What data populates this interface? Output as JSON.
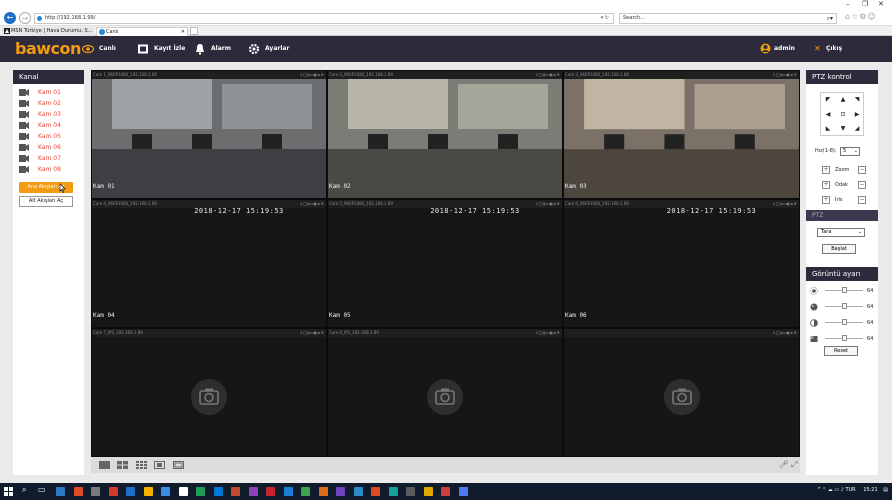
{
  "browser": {
    "url": "http://192.168.1.99/",
    "search_placeholder": "Search...",
    "tabs": [
      {
        "label": "MSN Türkiye | Hava Durumu, S..."
      },
      {
        "label": "Canlı"
      }
    ]
  },
  "app": {
    "logo": "bawcon",
    "nav": [
      {
        "label": "Canlı",
        "icon": "eye-icon"
      },
      {
        "label": "Kayıt İzle",
        "icon": "film-icon"
      },
      {
        "label": "Alarm",
        "icon": "bell-icon"
      },
      {
        "label": "Ayarlar",
        "icon": "gear-icon"
      }
    ],
    "user": "admin",
    "logout": "Çıkış",
    "accent_color": "#f39c12",
    "header_color": "#2c2a3b"
  },
  "left_panel": {
    "title": "Kanal",
    "channels": [
      "Kam 01",
      "Kam 02",
      "Kam 03",
      "Kam 04",
      "Kam 05",
      "Kam 06",
      "Kam 07",
      "Kam 08"
    ],
    "btn_main": "Ana Akışları Aç",
    "btn_sub": "Alt Akışları Aç"
  },
  "grid": {
    "cells": [
      {
        "header": "Cam 1_960P1080_192.168.1.89",
        "name": "Kam 01",
        "timestamp": "",
        "state": "video"
      },
      {
        "header": "Cam 2_960P1080_192.168.1.89",
        "name": "Kam 02",
        "timestamp": "",
        "state": "video"
      },
      {
        "header": "Cam 3_960P1080_192.168.1.89",
        "name": "Kam 03",
        "timestamp": "",
        "state": "video"
      },
      {
        "header": "Cam 4_960P1080_192.168.1.89",
        "name": "Kam 04",
        "timestamp": "2018-12-17 15:19:53",
        "state": "dark"
      },
      {
        "header": "Cam 5_960P1080_192.168.1.89",
        "name": "Kam 05",
        "timestamp": "2018-12-17 15:19:53",
        "state": "dark"
      },
      {
        "header": "Cam 6_960P1080_192.168.1.89",
        "name": "Kam 06",
        "timestamp": "2018-12-17 15:19:53",
        "state": "dark"
      },
      {
        "header": "Cam 7_IPS_192.168.1.89",
        "name": "",
        "timestamp": "",
        "state": "empty"
      },
      {
        "header": "Cam 8_IPS_192.168.1.89",
        "name": "",
        "timestamp": "",
        "state": "empty"
      },
      {
        "header": "",
        "name": "",
        "timestamp": "",
        "state": "empty"
      }
    ],
    "header_controls": "⇩▢◎▭◐◂ ✕"
  },
  "right_panel": {
    "ptz_title": "PTZ kontrol",
    "speed_label": "Hız(1-8):",
    "speed_value": "5",
    "controls": [
      {
        "label": "Zoom"
      },
      {
        "label": "Odak"
      },
      {
        "label": "İris"
      }
    ],
    "ptz_label": "PTZ",
    "tour_value": "Tara",
    "start_label": "Başlat",
    "image_title": "Görüntü ayarı",
    "sliders": [
      {
        "icon": "brightness-icon",
        "value": "64",
        "level": 0.5
      },
      {
        "icon": "saturation-icon",
        "value": "64",
        "level": 0.5
      },
      {
        "icon": "contrast-icon",
        "value": "64",
        "level": 0.5
      },
      {
        "icon": "hue-icon",
        "value": "64",
        "level": 0.5
      }
    ],
    "reset_label": "Reset"
  },
  "taskbar": {
    "lang": "TUR",
    "time": "15:21"
  }
}
